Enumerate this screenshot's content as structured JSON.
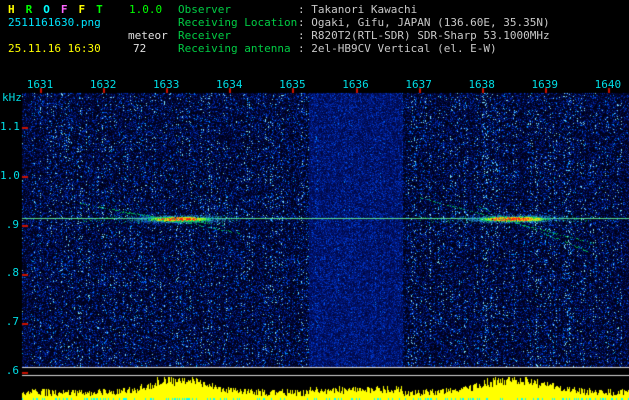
{
  "title": {
    "letters": [
      "H",
      "R",
      "O",
      "F",
      "F",
      "T"
    ],
    "letter_colors": [
      "#ffff00",
      "#00ff00",
      "#00ffff",
      "#ff66ff",
      "#ffff00",
      "#00ff00"
    ],
    "version": "1.0.0"
  },
  "file_info": {
    "filename": "2511161630.png",
    "mode": "meteor",
    "timestamp": "25.11.16 16:30",
    "count": "72"
  },
  "station": {
    "rows": [
      {
        "label": "Observer",
        "value": ": Takanori Kawachi"
      },
      {
        "label": "Receiving Location",
        "value": ": Ogaki, Gifu, JAPAN (136.60E, 35.35N)"
      },
      {
        "label": "Receiver",
        "value": ": R820T2(RTL-SDR) SDR-Sharp 53.1000MHz"
      },
      {
        "label": "Receiving antenna",
        "value": ": 2el-HB9CV Vertical (el. E-W)"
      }
    ]
  },
  "axes": {
    "x_labels": [
      "1631",
      "1632",
      "1633",
      "1634",
      "1635",
      "1636",
      "1637",
      "1638",
      "1639",
      "1640"
    ],
    "y_unit": "kHz",
    "y_labels": [
      "1.1",
      "1.0",
      ".9",
      ".8",
      ".7",
      ".6"
    ]
  },
  "spectrogram": {
    "time_start": 1631,
    "freq_top_khz": 1.1,
    "freq_step_khz": 0.1,
    "carrier_khz": 0.914,
    "interference_band": {
      "t_from": 1635.25,
      "t_to": 1636.75
    },
    "echo_events": [
      {
        "t_from": 1631.6,
        "t_center": 1633.2,
        "t_to": 1634.15,
        "f_khz": 0.914,
        "trails": [
          [
            1631.63,
            0.945,
            1634.15,
            0.884
          ],
          [
            1632.2,
            0.928,
            1633.9,
            0.9
          ]
        ]
      },
      {
        "t_from": 1637.0,
        "t_center": 1638.5,
        "t_to": 1639.75,
        "f_khz": 0.914,
        "trails": [
          [
            1637.0,
            0.957,
            1639.78,
            0.863
          ],
          [
            1637.9,
            0.94,
            1639.7,
            0.846
          ]
        ]
      }
    ]
  },
  "colors": {
    "background": "#000000",
    "version_green": "#00ff00",
    "filename_cyan": "#00e5ff",
    "mode_white": "#e0e0e0",
    "timestamp_yellow": "#ffff00",
    "count_white": "#e0e0e0",
    "station_label_green": "#00cc44",
    "station_value_gray": "#c8c8c8",
    "axis_text_cyan": "#00dde5",
    "tick_red": "#cc1100",
    "carrier_line_green": "#66ff99",
    "echo_core_red": "#ff2200",
    "echo_mid_yellow": "#ffd700",
    "echo_trail_green": "#00c85f",
    "level_bar_yellow": "#ffff00",
    "level_dot_cyan": "#00ffff",
    "separator_white": "#d8d8d8"
  }
}
